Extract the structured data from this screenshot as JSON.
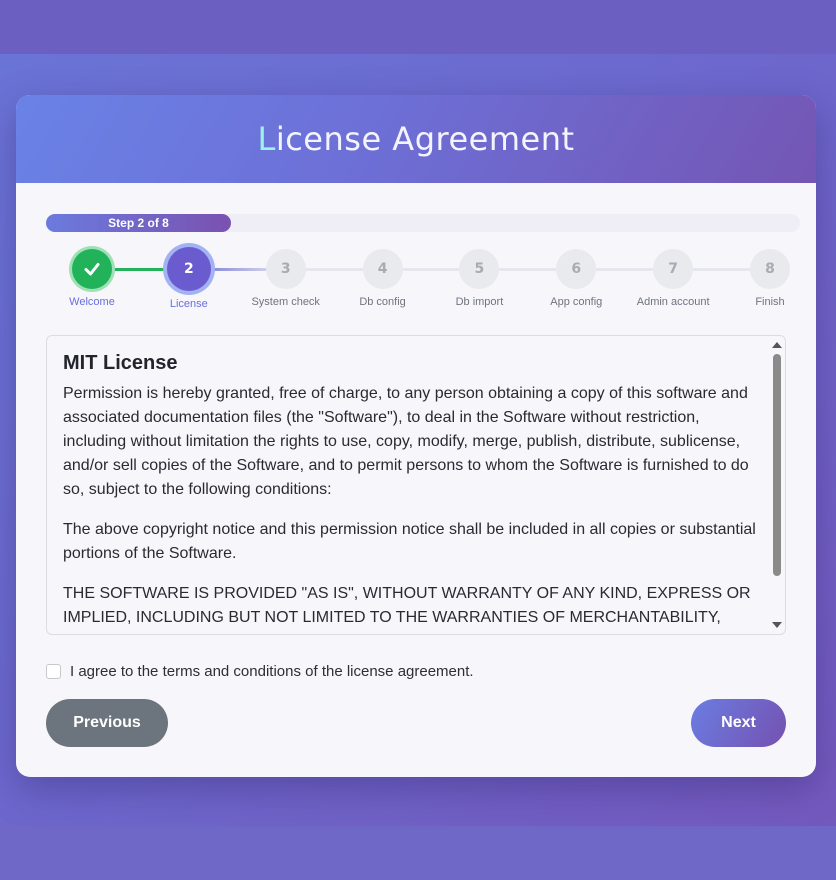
{
  "card": {
    "title_first": "L",
    "title_rest": "icense Agreement"
  },
  "progress": {
    "text": "Step 2 of 8",
    "fraction": 0.25
  },
  "steps": [
    {
      "number": "1",
      "label": "Welcome",
      "state": "completed",
      "icon": "check-icon"
    },
    {
      "number": "2",
      "label": "License",
      "state": "active"
    },
    {
      "number": "3",
      "label": "System check",
      "state": "pending"
    },
    {
      "number": "4",
      "label": "Db config",
      "state": "pending"
    },
    {
      "number": "5",
      "label": "Db import",
      "state": "pending"
    },
    {
      "number": "6",
      "label": "App config",
      "state": "pending"
    },
    {
      "number": "7",
      "label": "Admin account",
      "state": "pending"
    },
    {
      "number": "8",
      "label": "Finish",
      "state": "pending"
    }
  ],
  "license": {
    "heading": "MIT License",
    "paragraphs": [
      "Permission is hereby granted, free of charge, to any person obtaining a copy of this software and associated documentation files (the \"Software\"), to deal in the Software without restriction, including without limitation the rights to use, copy, modify, merge, publish, distribute, sublicense, and/or sell copies of the Software, and to permit persons to whom the Software is furnished to do so, subject to the following conditions:",
      "The above copyright notice and this permission notice shall be included in all copies or substantial portions of the Software.",
      "THE SOFTWARE IS PROVIDED \"AS IS\", WITHOUT WARRANTY OF ANY KIND, EXPRESS OR IMPLIED, INCLUDING BUT NOT LIMITED TO THE WARRANTIES OF MERCHANTABILITY, FITNESS FOR A PARTICULAR PURPOSE AND NONINFRINGEMENT."
    ]
  },
  "agreement": {
    "label": "I agree to the terms and conditions of the license agreement.",
    "checked": false
  },
  "buttons": {
    "previous": "Previous",
    "next": "Next"
  },
  "colors": {
    "completed": "#22b35a",
    "active": "#6a5ccf",
    "accent": "#6d6fd6",
    "previous_button": "#6c757d"
  }
}
